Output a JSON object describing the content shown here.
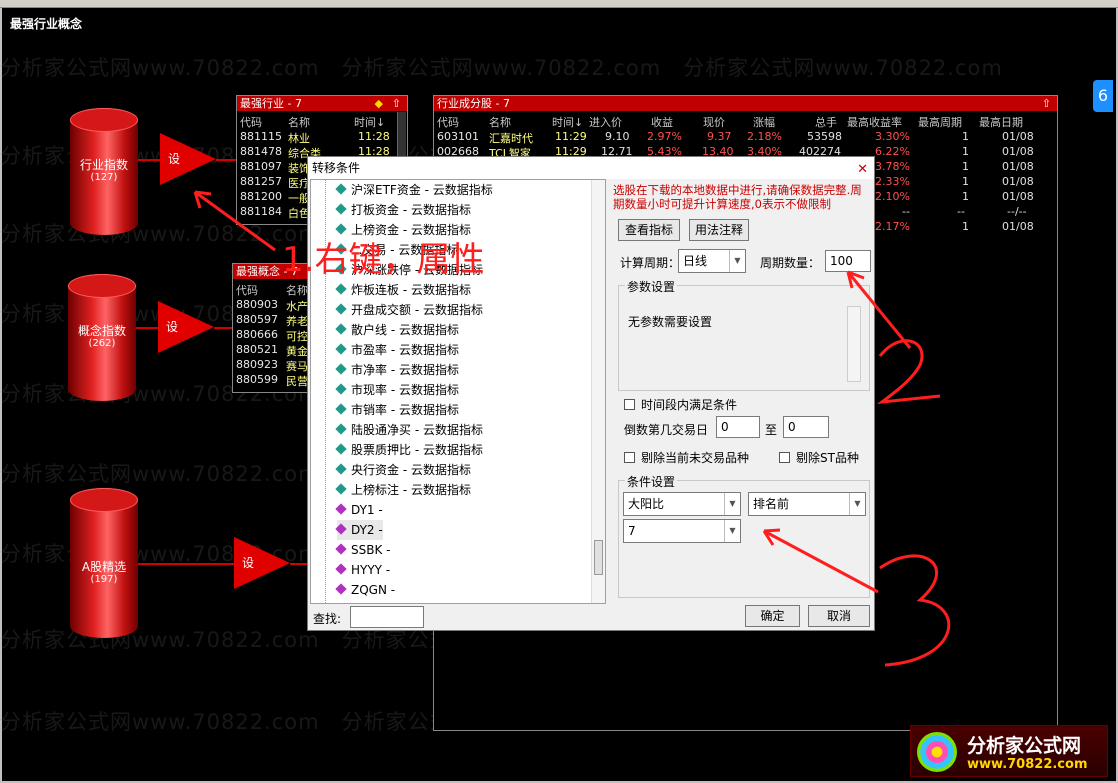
{
  "page_title": "最强行业概念",
  "watermark": "分析家公式网www.70822.com",
  "sources": [
    {
      "label": "行业指数",
      "count": "(127)",
      "arrow": "设"
    },
    {
      "label": "概念指数",
      "count": "(262)",
      "arrow": "设"
    },
    {
      "label": "A股精选",
      "count": "(197)",
      "arrow": "设"
    }
  ],
  "industry_panel": {
    "title": "最强行业 - 7",
    "headers": [
      "代码",
      "名称",
      "时间↓"
    ],
    "rows": [
      {
        "code": "881115",
        "name": "林业",
        "time": "11:28"
      },
      {
        "code": "881478",
        "name": "综合类",
        "time": "11:28"
      },
      {
        "code": "881097",
        "name": "装饰",
        "time": ""
      },
      {
        "code": "881257",
        "name": "医疗",
        "time": ""
      },
      {
        "code": "881200",
        "name": "一般",
        "time": ""
      },
      {
        "code": "881184",
        "name": "白色",
        "time": ""
      }
    ]
  },
  "concept_panel": {
    "title": "最强概念 - 7",
    "headers": [
      "代码",
      "名称"
    ],
    "rows": [
      {
        "code": "880903",
        "name": "水产"
      },
      {
        "code": "880597",
        "name": "养老"
      },
      {
        "code": "880666",
        "name": "可控"
      },
      {
        "code": "880521",
        "name": "黄金"
      },
      {
        "code": "880923",
        "name": "赛马"
      },
      {
        "code": "880599",
        "name": "民营"
      }
    ]
  },
  "stocks_panel": {
    "title": "行业成分股 - 7",
    "headers": [
      "代码",
      "名称",
      "时间↓",
      "进入价",
      "收益",
      "现价",
      "涨幅",
      "总手",
      "最高收益率",
      "最高周期",
      "最高日期"
    ],
    "rows": [
      [
        "603101",
        "汇嘉时代",
        "11:29",
        "9.10",
        "2.97%",
        "9.37",
        "2.18%",
        "53598",
        "3.30%",
        "1",
        "01/08"
      ],
      [
        "002668",
        "TCL智家",
        "11:29",
        "12.71",
        "5.43%",
        "13.40",
        "3.40%",
        "402274",
        "6.22%",
        "1",
        "01/08"
      ],
      [
        "",
        "",
        "",
        "",
        "",
        "",
        "",
        "",
        "3.78%",
        "1",
        "01/08"
      ],
      [
        "",
        "",
        "",
        "",
        "",
        "",
        "",
        "",
        "2.33%",
        "1",
        "01/08"
      ],
      [
        "",
        "",
        "",
        "",
        "",
        "",
        "",
        "",
        "2.10%",
        "1",
        "01/08"
      ],
      [
        "",
        "",
        "",
        "",
        "",
        "",
        "",
        "",
        "--",
        "--",
        "--/--"
      ],
      [
        "",
        "",
        "",
        "",
        "",
        "",
        "",
        "",
        "2.17%",
        "1",
        "01/08"
      ]
    ]
  },
  "dialog": {
    "title": "转移条件",
    "close": "✕",
    "tree_items": [
      {
        "label": "沪深ETF资金 - 云数据指标",
        "kind": "cloud"
      },
      {
        "label": "打板资金 - 云数据指标",
        "kind": "cloud"
      },
      {
        "label": "上榜资金 - 云数据指标",
        "kind": "cloud"
      },
      {
        "label": "...交易 - 云数据指标",
        "kind": "cloud"
      },
      {
        "label": "沪深涨跌停 - 云数据指标",
        "kind": "cloud"
      },
      {
        "label": "炸板连板 - 云数据指标",
        "kind": "cloud"
      },
      {
        "label": "开盘成交额 - 云数据指标",
        "kind": "cloud"
      },
      {
        "label": "散户线 - 云数据指标",
        "kind": "cloud"
      },
      {
        "label": "市盈率 - 云数据指标",
        "kind": "cloud"
      },
      {
        "label": "市净率 - 云数据指标",
        "kind": "cloud"
      },
      {
        "label": "市现率 - 云数据指标",
        "kind": "cloud"
      },
      {
        "label": "市销率 - 云数据指标",
        "kind": "cloud"
      },
      {
        "label": "陆股通净买 - 云数据指标",
        "kind": "cloud"
      },
      {
        "label": "股票质押比 - 云数据指标",
        "kind": "cloud"
      },
      {
        "label": "央行资金 - 云数据指标",
        "kind": "cloud"
      },
      {
        "label": "上榜标注 - 云数据指标",
        "kind": "cloud"
      },
      {
        "label": "DY1 -",
        "kind": "user"
      },
      {
        "label": "DY2 -",
        "kind": "user"
      },
      {
        "label": "SSBK -",
        "kind": "user"
      },
      {
        "label": "HYYY -",
        "kind": "user"
      },
      {
        "label": "ZQGN -",
        "kind": "user"
      }
    ],
    "note": "选股在下载的本地数据中进行,请确保数据完整.周期数量小时可提升计算速度,0表示不做限制",
    "btn_view": "查看指标",
    "btn_usage": "用法注释",
    "period_label": "计算周期：",
    "period_value": "日线",
    "count_label": "周期数量：",
    "count_value": "100",
    "params_group": "参数设置",
    "params_text": "无参数需要设置",
    "chk_timerange": "时间段内满足条件",
    "reverse_label": "倒数第几交易日",
    "reverse_from": "0",
    "to_label": "至",
    "reverse_to": "0",
    "chk_untraded": "剔除当前未交易品种",
    "chk_st": "剔除ST品种",
    "cond_group": "条件设置",
    "cond_field": "大阳比",
    "cond_op": "排名前",
    "cond_value": "7",
    "search_label": "查找:",
    "search_value": "",
    "ok": "确定",
    "cancel": "取消"
  },
  "annotations": {
    "step1": "1.右键，属性",
    "step2": "2",
    "step3": "3"
  },
  "logo": {
    "name": "分析家公式网",
    "url": "www.70822.com"
  },
  "colors": {
    "accent": "#c00000",
    "annotation": "#ff1e1e",
    "note": "#cc0000"
  }
}
